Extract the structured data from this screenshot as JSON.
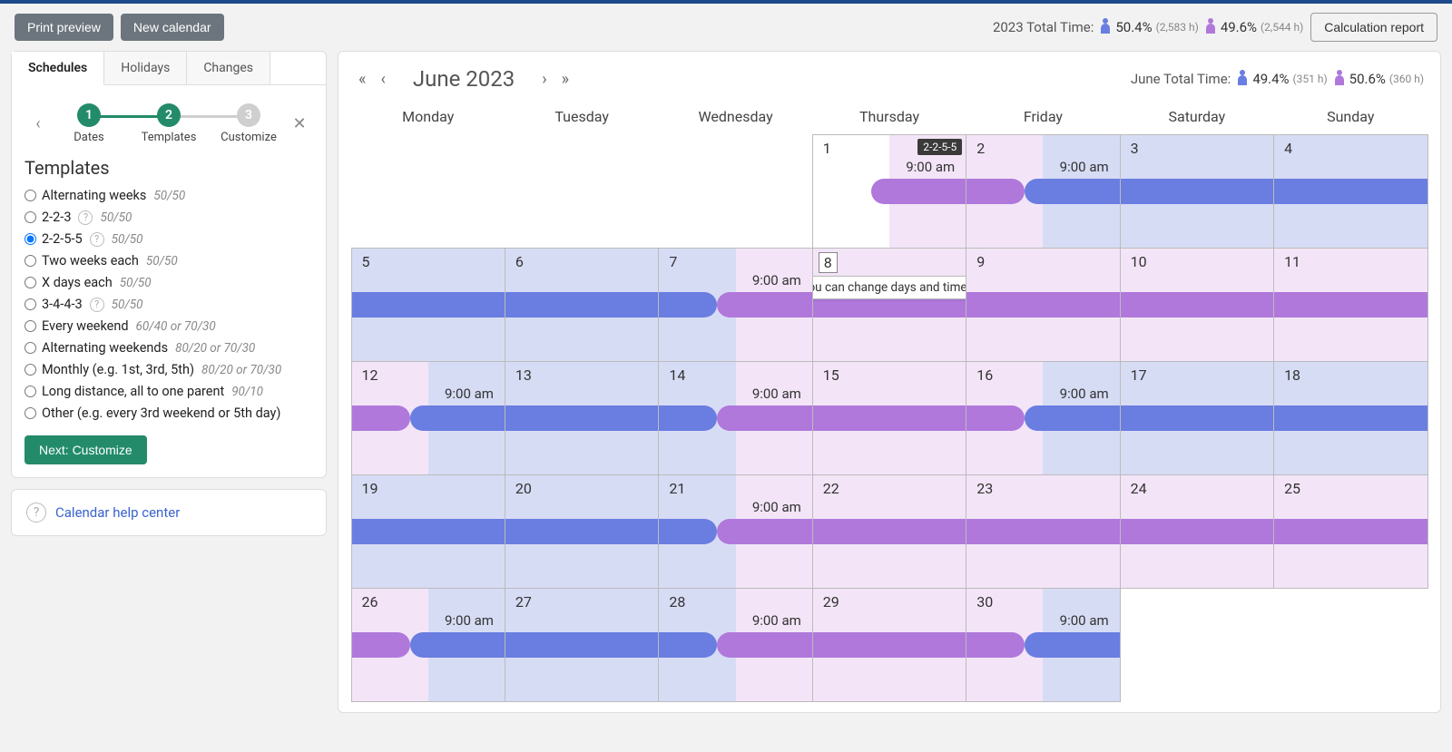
{
  "toolbar": {
    "print_preview": "Print preview",
    "new_calendar": "New calendar",
    "calc_report": "Calculation report"
  },
  "year_time": {
    "label": "2023 Total Time:",
    "a_pct": "50.4%",
    "a_hours": "(2,583 h)",
    "b_pct": "49.6%",
    "b_hours": "(2,544 h)"
  },
  "tabs": {
    "schedules": "Schedules",
    "holidays": "Holidays",
    "changes": "Changes"
  },
  "stepper": {
    "s1": "1",
    "s1_label": "Dates",
    "s2": "2",
    "s2_label": "Templates",
    "s3": "3",
    "s3_label": "Customize"
  },
  "templates_title": "Templates",
  "templates": [
    {
      "label": "Alternating weeks",
      "sub": "50/50",
      "q": false,
      "sel": false
    },
    {
      "label": "2-2-3",
      "sub": "50/50",
      "q": true,
      "sel": false
    },
    {
      "label": "2-2-5-5",
      "sub": "50/50",
      "q": true,
      "sel": true
    },
    {
      "label": "Two weeks each",
      "sub": "50/50",
      "q": false,
      "sel": false
    },
    {
      "label": "X days each",
      "sub": "50/50",
      "q": false,
      "sel": false
    },
    {
      "label": "3-4-4-3",
      "sub": "50/50",
      "q": true,
      "sel": false
    },
    {
      "label": "Every weekend",
      "sub": "60/40 or 70/30",
      "q": false,
      "sel": false
    },
    {
      "label": "Alternating weekends",
      "sub": "80/20 or 70/30",
      "q": false,
      "sel": false
    },
    {
      "label": "Monthly (e.g. 1st, 3rd, 5th)",
      "sub": "80/20 or 70/30",
      "q": false,
      "sel": false
    },
    {
      "label": "Long distance, all to one parent",
      "sub": "90/10",
      "q": false,
      "sel": false
    },
    {
      "label": "Other (e.g. every 3rd weekend or 5th day)",
      "sub": "",
      "q": false,
      "sel": false
    }
  ],
  "next_button": "Next: Customize",
  "help_link": "Calendar help center",
  "month_title": "June 2023",
  "month_time": {
    "label": "June Total Time:",
    "a_pct": "49.4%",
    "a_hours": "(351 h)",
    "b_pct": "50.6%",
    "b_hours": "(360 h)"
  },
  "dow": [
    "Monday",
    "Tuesday",
    "Wednesday",
    "Thursday",
    "Friday",
    "Saturday",
    "Sunday"
  ],
  "time_900": "9:00 am",
  "tooltip": "You can change days and times in the next step",
  "badge_2255": "2-2-5-5",
  "colors": {
    "parent_a_bg": "#d7dcf5",
    "parent_b_bg": "#f3e5f7",
    "bar_blue": "#6a7de0",
    "bar_purple": "#b078db",
    "accent_green": "#238b6a"
  }
}
